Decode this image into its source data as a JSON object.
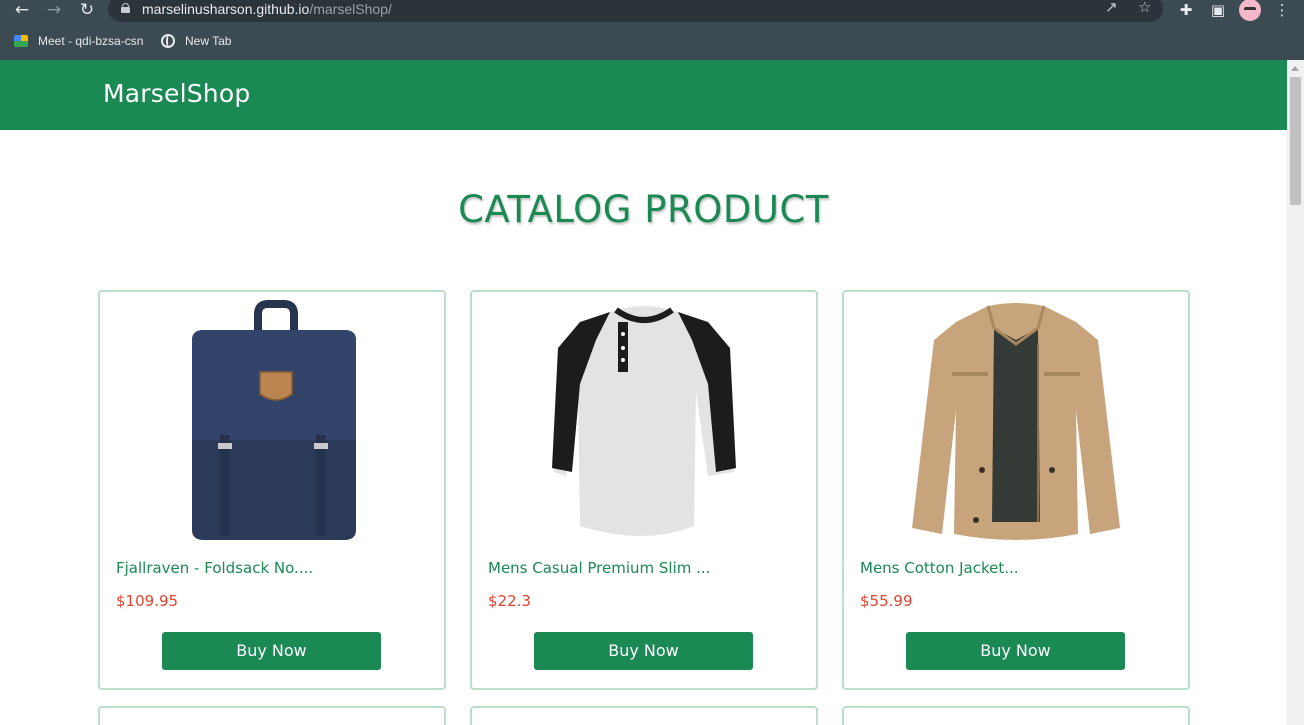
{
  "browser": {
    "url_host": "marselinusharson.github.io",
    "url_path": "/marselShop/",
    "bookmarks": [
      {
        "label": "Meet - qdi-bzsa-csn",
        "icon": "google-meet-icon"
      },
      {
        "label": "New Tab",
        "icon": "globe-icon"
      }
    ]
  },
  "header": {
    "brand": "MarselShop",
    "color": "#1b8953"
  },
  "page": {
    "title": "CATALOG PRODUCT"
  },
  "products": [
    {
      "name": "Fjallraven - Foldsack No....",
      "price": "$109.95",
      "button": "Buy Now",
      "image": "backpack-image"
    },
    {
      "name": "Mens Casual Premium Slim ...",
      "price": "$22.3",
      "button": "Buy Now",
      "image": "raglan-shirt-image"
    },
    {
      "name": "Mens Cotton Jacket...",
      "price": "$55.99",
      "button": "Buy Now",
      "image": "cotton-jacket-image"
    }
  ],
  "colors": {
    "accent": "#1b8953",
    "price": "#e2442f",
    "card_border": "#b9dfcb"
  }
}
